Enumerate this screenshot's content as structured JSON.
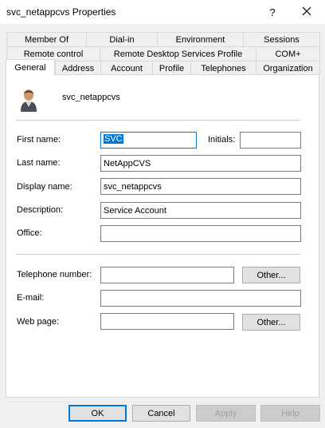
{
  "window": {
    "title": "svc_netappcvs Properties"
  },
  "titlebar": {
    "help": "?",
    "close_icon": "close-icon"
  },
  "tabs": {
    "row1": [
      "Member Of",
      "Dial-in",
      "Environment",
      "Sessions"
    ],
    "row2": [
      "Remote control",
      "Remote Desktop Services Profile",
      "COM+"
    ],
    "row3": [
      "General",
      "Address",
      "Account",
      "Profile",
      "Telephones",
      "Organization"
    ],
    "active": "General"
  },
  "header": {
    "user_name": "svc_netappcvs",
    "avatar_icon": "user-icon"
  },
  "form": {
    "first_name_label": "First name:",
    "first_name_value": "SVC",
    "initials_label": "Initials:",
    "initials_value": "",
    "last_name_label": "Last name:",
    "last_name_value": "NetAppCVS",
    "display_name_label": "Display name:",
    "display_name_value": "svc_netappcvs",
    "description_label": "Description:",
    "description_value": "Service Account",
    "office_label": "Office:",
    "office_value": "",
    "telephone_label": "Telephone number:",
    "telephone_value": "",
    "telephone_other": "Other...",
    "email_label": "E-mail:",
    "email_value": "",
    "webpage_label": "Web page:",
    "webpage_value": "",
    "webpage_other": "Other..."
  },
  "footer": {
    "ok": "OK",
    "cancel": "Cancel",
    "apply": "Apply",
    "help": "Help"
  },
  "colors": {
    "accent": "#0078d7",
    "panel": "#ffffff",
    "chrome": "#f0f0f0"
  }
}
